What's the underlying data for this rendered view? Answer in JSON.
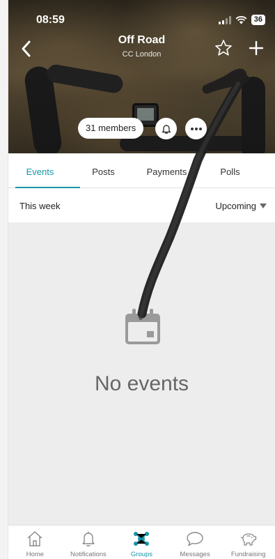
{
  "status": {
    "time": "08:59",
    "battery": "36"
  },
  "header": {
    "title": "Off Road",
    "subtitle": "CC London"
  },
  "chips": {
    "members": "31 members"
  },
  "tabs": [
    {
      "label": "Events",
      "active": true
    },
    {
      "label": "Posts",
      "active": false
    },
    {
      "label": "Payments",
      "active": false
    },
    {
      "label": "Polls",
      "active": false
    }
  ],
  "filter": {
    "period": "This week",
    "sort": "Upcoming"
  },
  "empty_state": {
    "message": "No events",
    "icon": "calendar-icon"
  },
  "bottom_nav": [
    {
      "label": "Home",
      "icon": "home-icon",
      "active": false
    },
    {
      "label": "Notifications",
      "icon": "bell-icon",
      "active": false
    },
    {
      "label": "Groups",
      "icon": "groups-icon",
      "active": true
    },
    {
      "label": "Messages",
      "icon": "chat-bubble-icon",
      "active": false
    },
    {
      "label": "Fundraising",
      "icon": "piggy-bank-icon",
      "active": false
    }
  ],
  "colors": {
    "accent": "#1895a8",
    "empty_bg": "#ededed",
    "text_muted": "#777777"
  }
}
